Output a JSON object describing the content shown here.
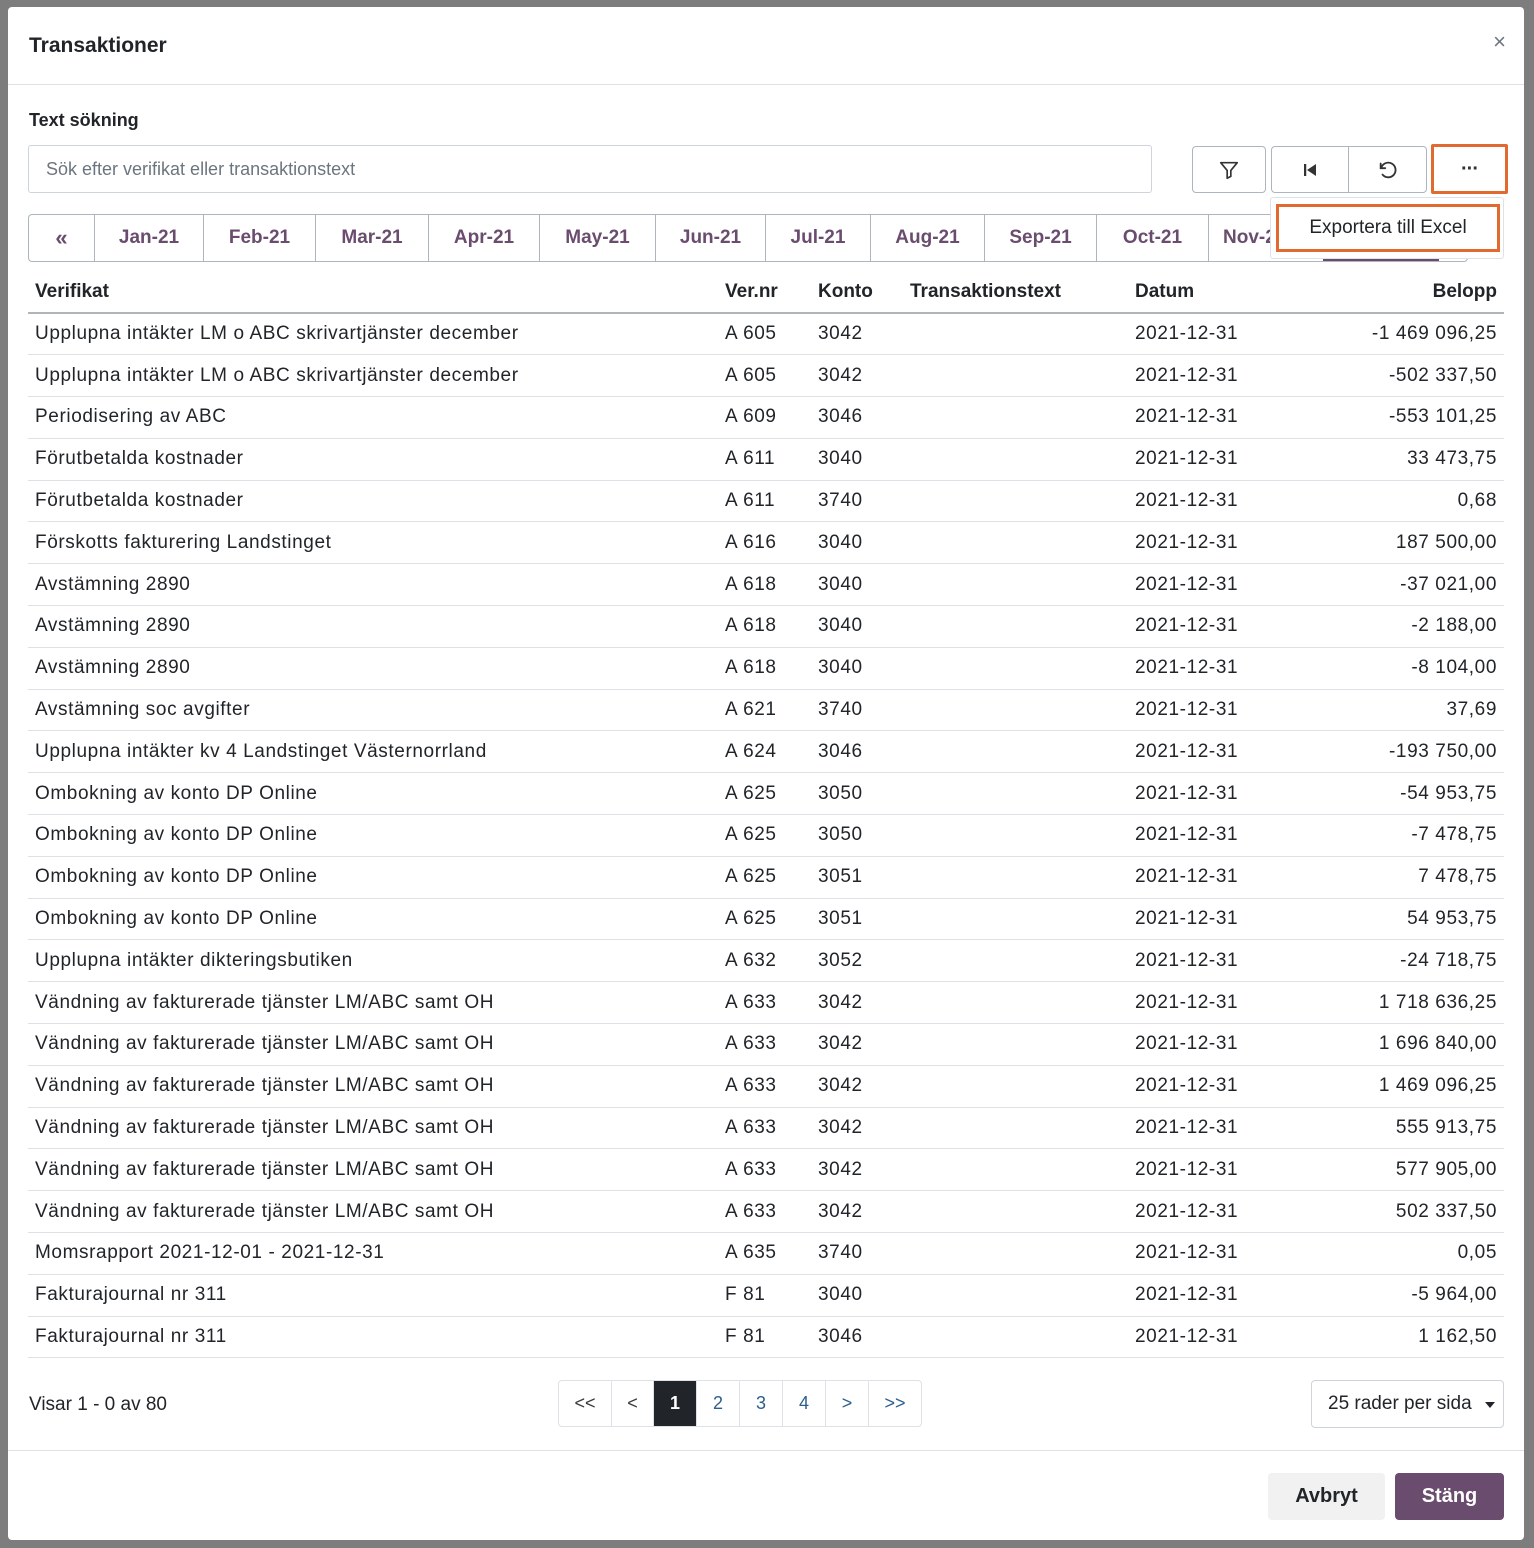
{
  "modal": {
    "title": "Transaktioner",
    "close_glyph": "×"
  },
  "search": {
    "label": "Text sökning",
    "placeholder": "Sök efter verifikat eller transaktionstext"
  },
  "toolbar": {
    "more_glyph": "···",
    "menu_item": "Exportera till Excel"
  },
  "months": {
    "prev_label": "«",
    "items": [
      "Jan-21",
      "Feb-21",
      "Mar-21",
      "Apr-21",
      "May-21",
      "Jun-21",
      "Jul-21",
      "Aug-21",
      "Sep-21",
      "Oct-21",
      "Nov-21"
    ]
  },
  "table": {
    "headers": [
      "Verifikat",
      "Ver.nr",
      "Konto",
      "Transaktionstext",
      "Datum",
      "Belopp"
    ],
    "rows": [
      [
        "Upplupna intäkter LM o ABC skrivartjänster december",
        "A 605",
        "3042",
        "",
        "2021-12-31",
        "-1 469 096,25"
      ],
      [
        "Upplupna intäkter LM o ABC skrivartjänster december",
        "A 605",
        "3042",
        "",
        "2021-12-31",
        "-502 337,50"
      ],
      [
        "Periodisering av ABC",
        "A 609",
        "3046",
        "",
        "2021-12-31",
        "-553 101,25"
      ],
      [
        "Förutbetalda kostnader",
        "A 611",
        "3040",
        "",
        "2021-12-31",
        "33 473,75"
      ],
      [
        "Förutbetalda kostnader",
        "A 611",
        "3740",
        "",
        "2021-12-31",
        "0,68"
      ],
      [
        "Förskotts fakturering Landstinget",
        "A 616",
        "3040",
        "",
        "2021-12-31",
        "187 500,00"
      ],
      [
        "Avstämning 2890",
        "A 618",
        "3040",
        "",
        "2021-12-31",
        "-37 021,00"
      ],
      [
        "Avstämning 2890",
        "A 618",
        "3040",
        "",
        "2021-12-31",
        "-2 188,00"
      ],
      [
        "Avstämning 2890",
        "A 618",
        "3040",
        "",
        "2021-12-31",
        "-8 104,00"
      ],
      [
        "Avstämning soc avgifter",
        "A 621",
        "3740",
        "",
        "2021-12-31",
        "37,69"
      ],
      [
        "Upplupna intäkter kv 4 Landstinget Västernorrland",
        "A 624",
        "3046",
        "",
        "2021-12-31",
        "-193 750,00"
      ],
      [
        "Ombokning av konto DP Online",
        "A 625",
        "3050",
        "",
        "2021-12-31",
        "-54 953,75"
      ],
      [
        "Ombokning av konto DP Online",
        "A 625",
        "3050",
        "",
        "2021-12-31",
        "-7 478,75"
      ],
      [
        "Ombokning av konto DP Online",
        "A 625",
        "3051",
        "",
        "2021-12-31",
        "7 478,75"
      ],
      [
        "Ombokning av konto DP Online",
        "A 625",
        "3051",
        "",
        "2021-12-31",
        "54 953,75"
      ],
      [
        "Upplupna intäkter dikteringsbutiken",
        "A 632",
        "3052",
        "",
        "2021-12-31",
        "-24 718,75"
      ],
      [
        "Vändning av fakturerade tjänster LM/ABC samt OH",
        "A 633",
        "3042",
        "",
        "2021-12-31",
        "1 718 636,25"
      ],
      [
        "Vändning av fakturerade tjänster LM/ABC samt OH",
        "A 633",
        "3042",
        "",
        "2021-12-31",
        "1 696 840,00"
      ],
      [
        "Vändning av fakturerade tjänster LM/ABC samt OH",
        "A 633",
        "3042",
        "",
        "2021-12-31",
        "1 469 096,25"
      ],
      [
        "Vändning av fakturerade tjänster LM/ABC samt OH",
        "A 633",
        "3042",
        "",
        "2021-12-31",
        "555 913,75"
      ],
      [
        "Vändning av fakturerade tjänster LM/ABC samt OH",
        "A 633",
        "3042",
        "",
        "2021-12-31",
        "577 905,00"
      ],
      [
        "Vändning av fakturerade tjänster LM/ABC samt OH",
        "A 633",
        "3042",
        "",
        "2021-12-31",
        "502 337,50"
      ],
      [
        "Momsrapport 2021-12-01 - 2021-12-31",
        "A 635",
        "3740",
        "",
        "2021-12-31",
        "0,05"
      ],
      [
        "Fakturajournal nr 311",
        "F 81",
        "3040",
        "",
        "2021-12-31",
        "-5 964,00"
      ],
      [
        "Fakturajournal nr 311",
        "F 81",
        "3046",
        "",
        "2021-12-31",
        "1 162,50"
      ]
    ]
  },
  "pagination": {
    "info": "Visar 1 - 0 av 80",
    "first": "<<",
    "prev": "<",
    "pages": [
      "1",
      "2",
      "3",
      "4"
    ],
    "active_page": "1",
    "next": ">",
    "last": ">>",
    "rows_per_page": "25 rader per sida"
  },
  "footer": {
    "cancel_label": "Avbryt",
    "close_label": "Stäng"
  },
  "colors": {
    "accent": "#6a4d6e",
    "highlight": "#e06a2f"
  }
}
